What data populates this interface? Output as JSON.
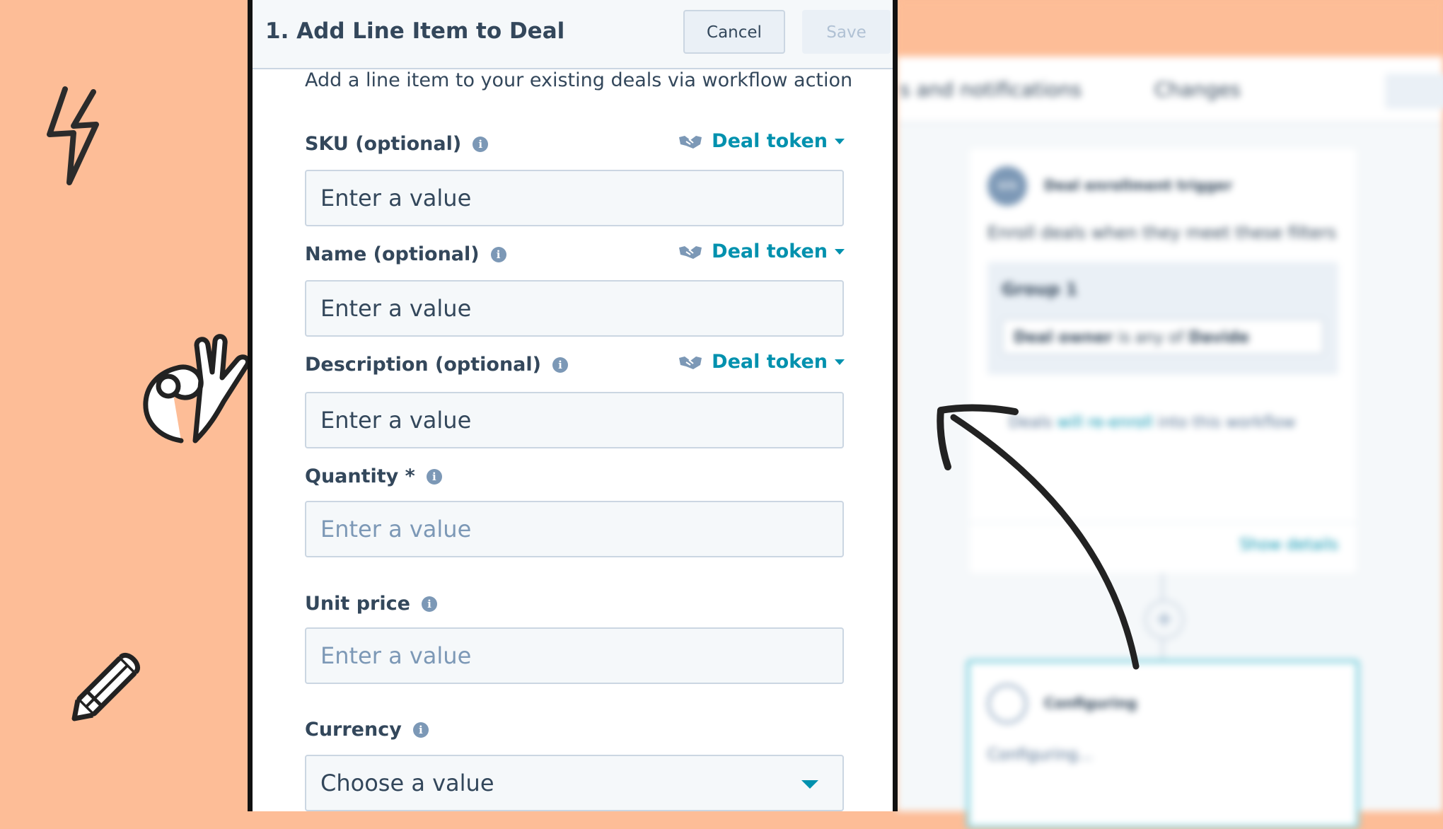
{
  "modal": {
    "title": "1. Add Line Item to Deal",
    "cancel_label": "Cancel",
    "save_label": "Save",
    "subtitle": "Add a line item to your existing deals via workflow action"
  },
  "fields": [
    {
      "label": "SKU (optional)",
      "value": "Enter a value",
      "token": "Deal token"
    },
    {
      "label": "Name (optional)",
      "value": "Enter a value",
      "token": "Deal token"
    },
    {
      "label": "Description (optional)",
      "value": "Enter a value",
      "token": "Deal token"
    },
    {
      "label": "Quantity *",
      "placeholder": "Enter a value"
    },
    {
      "label": "Unit price",
      "placeholder": "Enter a value"
    },
    {
      "label": "Currency",
      "placeholder": "Choose a value"
    }
  ],
  "info_glyph": "i",
  "background": {
    "tabs": [
      "s and notifications",
      "Changes"
    ],
    "trigger_card": {
      "avatar": "WN",
      "title": "Deal enrollment trigger",
      "description": "Enroll deals when they meet these filters",
      "group_title": "Group 1",
      "filter": {
        "prefix": "Deal owner",
        "middle": " is any of ",
        "value": "Davide"
      },
      "reenroll": {
        "pre": "Deals ",
        "link": "will re-enroll",
        "post": " into this workflow"
      },
      "show_details": "Show details"
    },
    "config_card": {
      "title": "Configuring",
      "body": "Configuring..."
    }
  },
  "colors": {
    "page_background": "#FDBD97",
    "accent": "#0091AE",
    "text": "#33475B",
    "input_background": "#F5F8FA",
    "border": "#CBD6E2"
  },
  "icons": [
    "lightning-icon",
    "ok-hand-icon",
    "pencil-icon",
    "curved-arrow-icon",
    "handshake-icon",
    "info-icon",
    "chevron-down-icon"
  ]
}
